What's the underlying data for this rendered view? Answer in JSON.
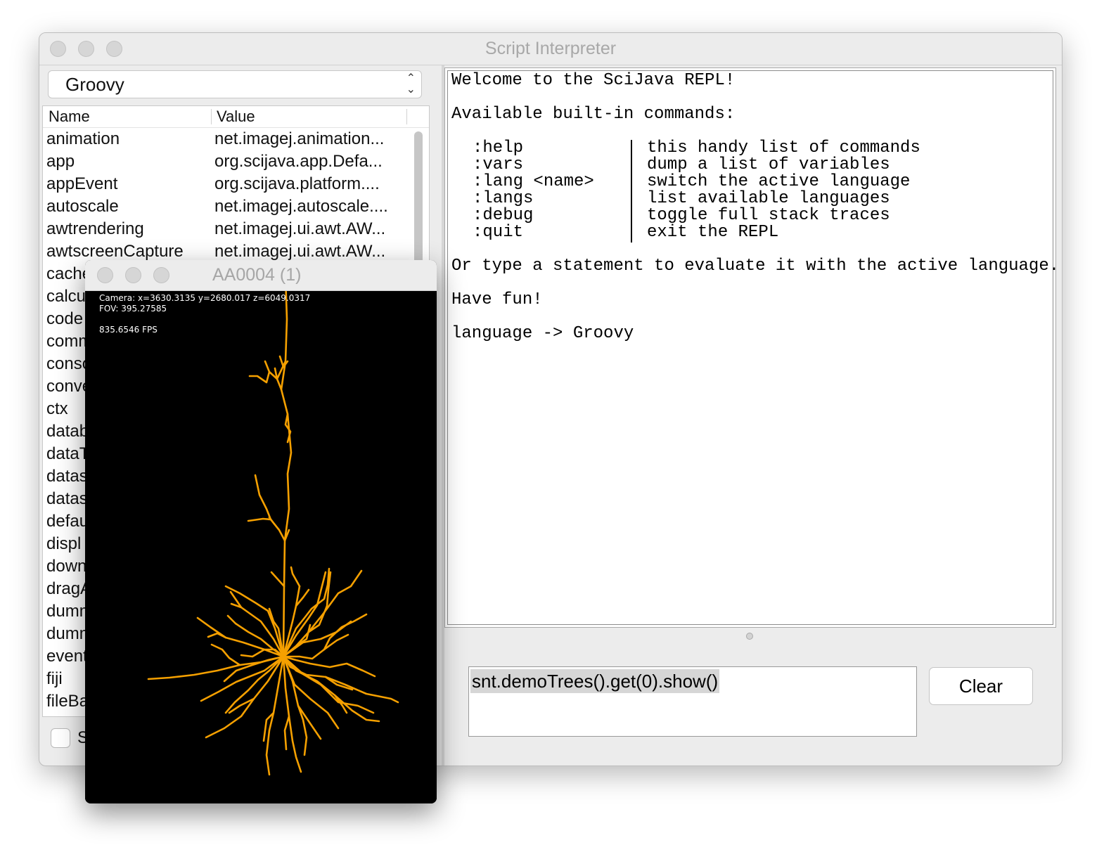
{
  "main_window": {
    "title": "Script Interpreter"
  },
  "language_select": {
    "value": "Groovy"
  },
  "variables_table": {
    "columns": [
      "Name",
      "Value"
    ],
    "rows": [
      {
        "name": "animation",
        "value": "net.imagej.animation..."
      },
      {
        "name": "app",
        "value": "org.scijava.app.Defa..."
      },
      {
        "name": "appEvent",
        "value": "org.scijava.platform...."
      },
      {
        "name": "autoscale",
        "value": "net.imagej.autoscale...."
      },
      {
        "name": "awtrendering",
        "value": "net.imagej.ui.awt.AW..."
      },
      {
        "name": "awtscreenCapture",
        "value": "net.imagej.ui.awt.AW..."
      },
      {
        "name": "cache",
        "value": ""
      },
      {
        "name": "calcu",
        "value": ""
      },
      {
        "name": "code",
        "value": ""
      },
      {
        "name": "comm",
        "value": ""
      },
      {
        "name": "conso",
        "value": ""
      },
      {
        "name": "conve",
        "value": ""
      },
      {
        "name": "ctx",
        "value": ""
      },
      {
        "name": "datab",
        "value": ""
      },
      {
        "name": "dataT",
        "value": ""
      },
      {
        "name": "datas",
        "value": ""
      },
      {
        "name": "datas",
        "value": ""
      },
      {
        "name": "defau",
        "value": ""
      },
      {
        "name": "displ",
        "value": ""
      },
      {
        "name": "down",
        "value": ""
      },
      {
        "name": "dragA",
        "value": ""
      },
      {
        "name": "dumm",
        "value": ""
      },
      {
        "name": "dumm",
        "value": ""
      },
      {
        "name": "event",
        "value": ""
      },
      {
        "name": "fiji",
        "value": ""
      },
      {
        "name": "fileBa",
        "value": ""
      }
    ]
  },
  "show_checkbox": {
    "label": "S",
    "checked": false
  },
  "output": {
    "welcome": "Welcome to the SciJava REPL!",
    "commands_header": "Available built-in commands:",
    "commands": [
      {
        "cmd": ":help",
        "desc": "this handy list of commands"
      },
      {
        "cmd": ":vars",
        "desc": "dump a list of variables"
      },
      {
        "cmd": ":lang <name>",
        "desc": "switch the active language"
      },
      {
        "cmd": ":langs",
        "desc": "list available languages"
      },
      {
        "cmd": ":debug",
        "desc": "toggle full stack traces"
      },
      {
        "cmd": ":quit",
        "desc": "exit the REPL"
      }
    ],
    "statement_hint": "Or type a statement to evaluate it with the active language.",
    "have_fun": "Have fun!",
    "language_line": "language -> Groovy"
  },
  "input": {
    "value": "snt.demoTrees().get(0).show()"
  },
  "clear_button": {
    "label": "Clear"
  },
  "viewer_window": {
    "title": "AA0004 (1)",
    "camera_text": "Camera: x=3630.3135 y=2680.017 z=6049.0317",
    "fov_text": "FOV: 395.27585",
    "fps_text": "835.6546 FPS"
  },
  "colors": {
    "neuron": "#f5a000",
    "viewer_background": "#000000",
    "window_background": "#ececec"
  }
}
